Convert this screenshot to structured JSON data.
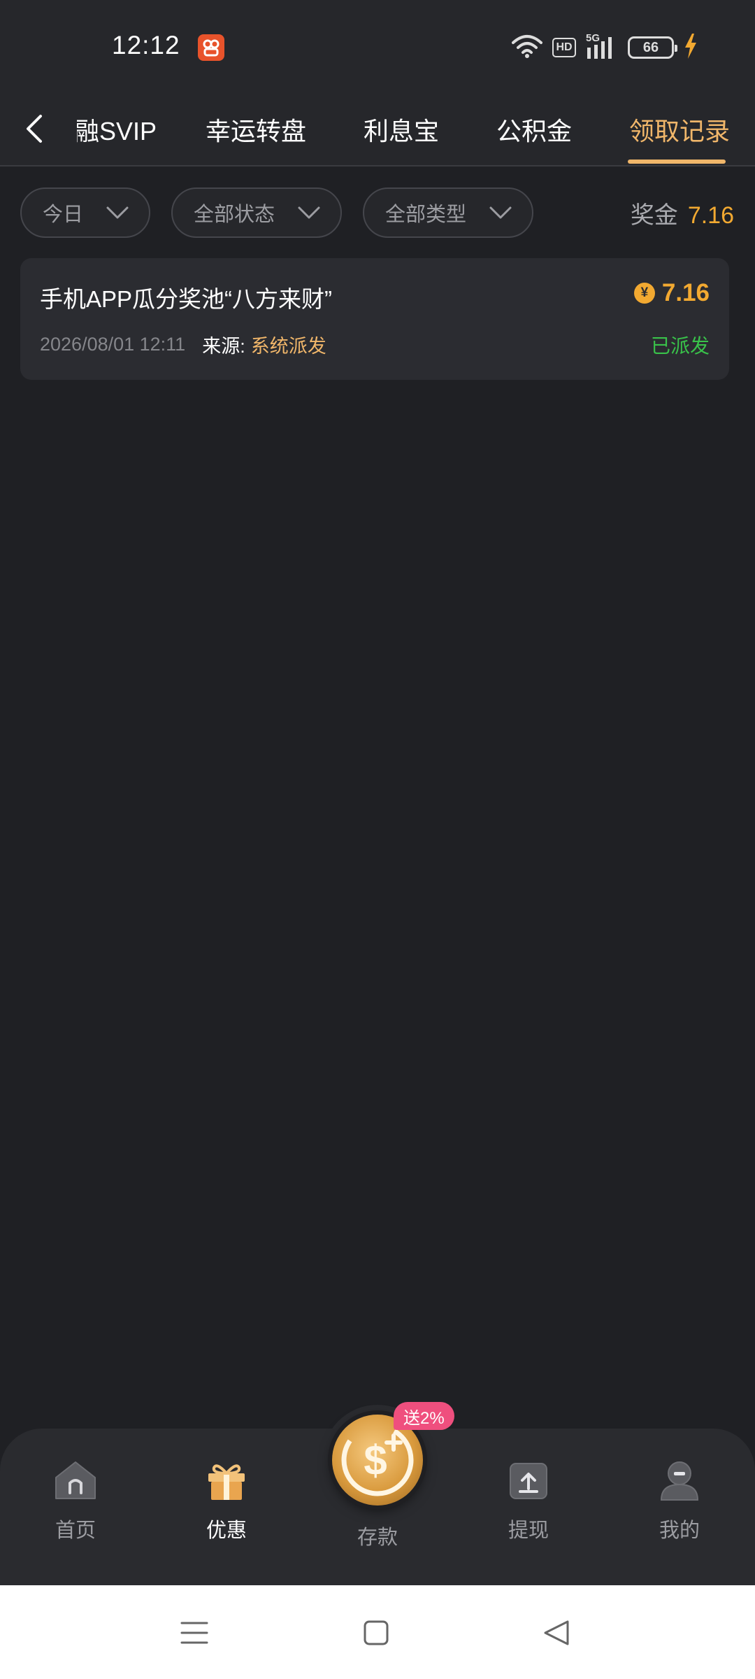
{
  "status_bar": {
    "time": "12:12",
    "network": "5G",
    "hd": "HD",
    "battery": "66",
    "icons": [
      "app-notification-icon",
      "wifi-icon",
      "hd-icon",
      "signal-icon",
      "battery-icon",
      "charging-icon"
    ]
  },
  "nav": {
    "tabs": [
      {
        "label": "融SVIP",
        "active": false
      },
      {
        "label": "幸运转盘",
        "active": false
      },
      {
        "label": "利息宝",
        "active": false
      },
      {
        "label": "公积金",
        "active": false
      },
      {
        "label": "领取记录",
        "active": true
      }
    ]
  },
  "filters": {
    "date": "今日",
    "status": "全部状态",
    "type": "全部类型"
  },
  "bonus": {
    "label": "奖金",
    "value": "7.16"
  },
  "records": [
    {
      "title": "手机APP瓜分奖池“八方来财”",
      "coin_symbol": "¥",
      "amount": "7.16",
      "time": "2026/08/01 12:11",
      "source_label": "来源:",
      "source": "系统派发",
      "status": "已派发"
    }
  ],
  "tabbar": {
    "home": "首页",
    "promo": "优惠",
    "deposit": "存款",
    "deposit_badge": "送2%",
    "withdraw": "提现",
    "mine": "我的",
    "active": "promo"
  },
  "colors": {
    "accent": "#f0b66a",
    "amount": "#f2a931",
    "success": "#39c24a",
    "badge": "#ef4f7e",
    "background": "#1f2024",
    "card": "#2b2c31"
  }
}
